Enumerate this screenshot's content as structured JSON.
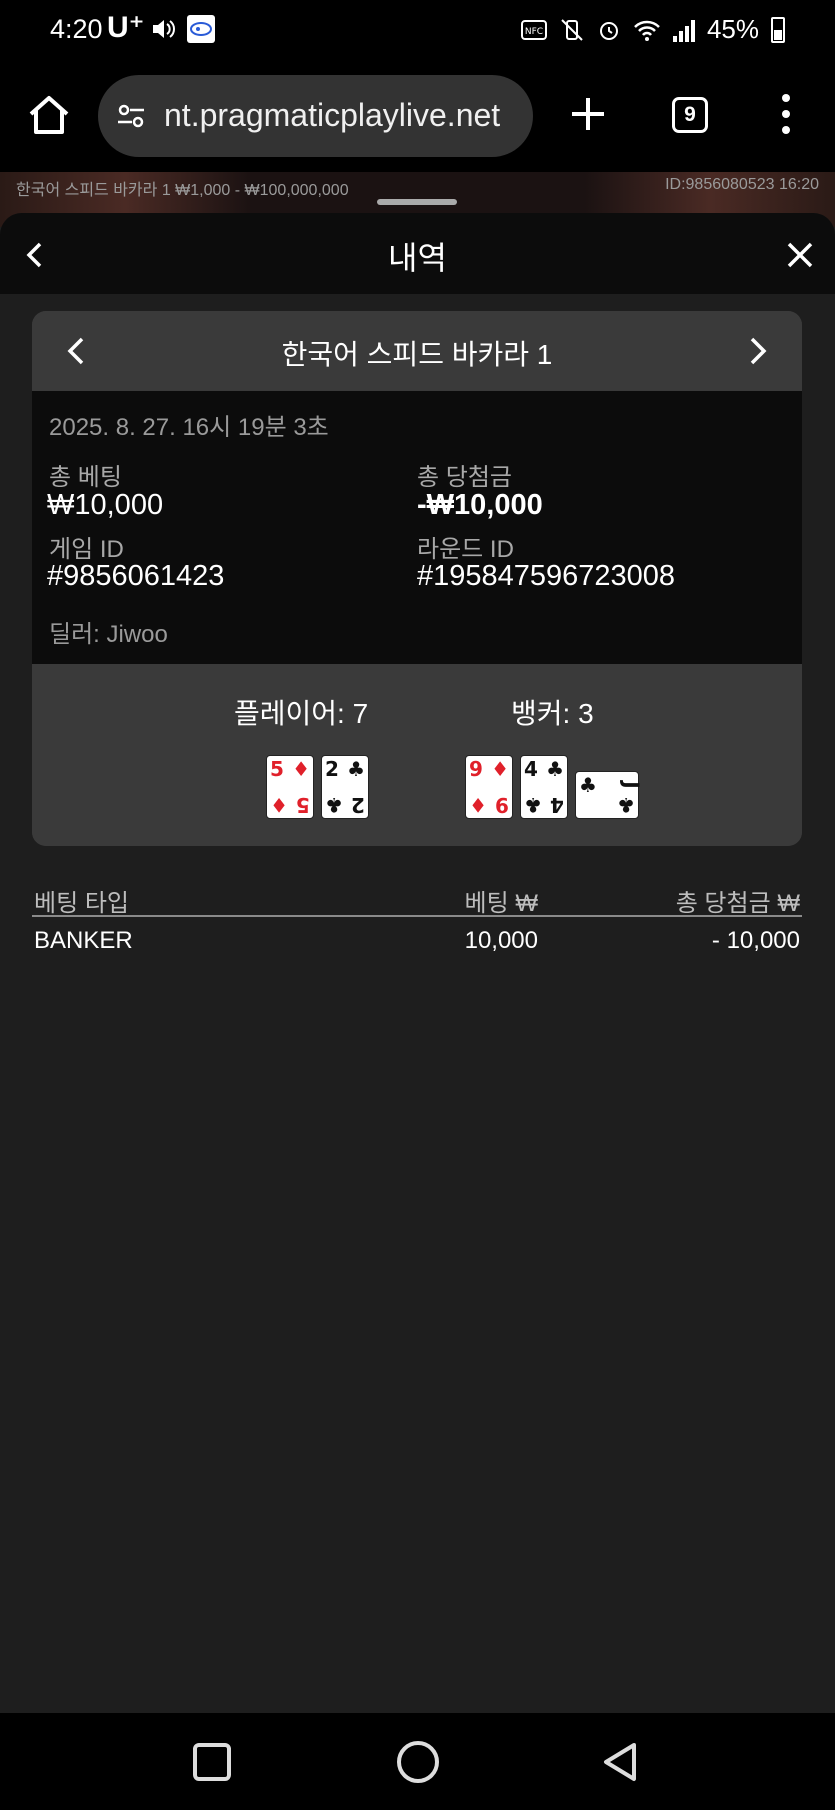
{
  "status_bar": {
    "time": "4:20",
    "carrier": "U⁺",
    "battery": "45%"
  },
  "browser": {
    "url": "nt.pragmaticplaylive.net",
    "tab_count": "9"
  },
  "game_info": {
    "left": "한국어 스피드 바카라 1  ₩1,000 - ₩100,000,000",
    "right": "ID:9856080523  16:20"
  },
  "sheet": {
    "title": "내역"
  },
  "round": {
    "game_name": "한국어 스피드 바카라 1",
    "date": "2025. 8. 27. 16시 19분 3초",
    "total_bet_label": "총 베팅",
    "total_bet_value": "₩10,000",
    "total_win_label": "총 당첨금",
    "total_win_value": "-₩10,000",
    "game_id_label": "게임 ID",
    "game_id_value": "#9856061423",
    "round_id_label": "라운드 ID",
    "round_id_value": "#195847596723008",
    "dealer": "딜러: Jiwoo"
  },
  "result": {
    "player_label": "플레이어: 7",
    "banker_label": "뱅커: 3",
    "player_cards": [
      {
        "rank": "5",
        "suit": "♦",
        "color": "red"
      },
      {
        "rank": "2",
        "suit": "♣",
        "color": "black"
      }
    ],
    "banker_cards": [
      {
        "rank": "9",
        "suit": "♦",
        "color": "red"
      },
      {
        "rank": "4",
        "suit": "♣",
        "color": "black"
      },
      {
        "rank": "J",
        "suit": "♣",
        "color": "black",
        "sideways": true
      }
    ]
  },
  "bets_table": {
    "headers": [
      "베팅 타입",
      "베팅 ₩",
      "총 당첨금 ₩"
    ],
    "rows": [
      [
        "BANKER",
        "10,000",
        "- 10,000"
      ]
    ]
  },
  "colors": {
    "background": "#1e1e1e",
    "card_panel": "#3a3a3a",
    "info_panel": "#0c0c0c",
    "red_suit": "#e0202a"
  }
}
